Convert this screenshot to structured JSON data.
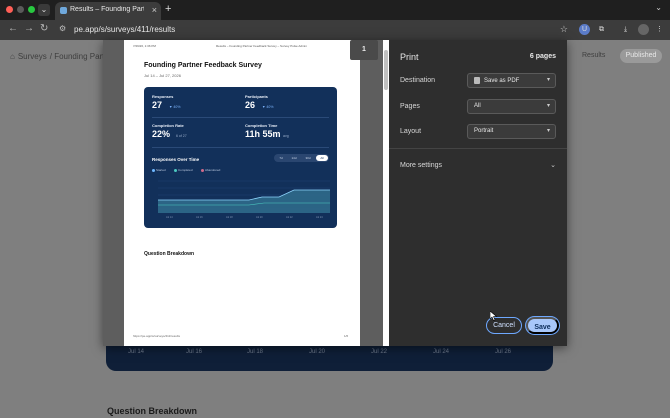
{
  "browser": {
    "tab_title": "Results – Founding Partner F...",
    "tab_close": "×",
    "new_tab": "+",
    "url": "pe.app/s/surveys/411/results",
    "ext_label": "U"
  },
  "page": {
    "breadcrumb": [
      "Surveys",
      "/ Founding Partne"
    ],
    "results_label": "Results",
    "published_label": "Published",
    "x_labels": [
      "Jul 14",
      "Jul 16",
      "Jul 18",
      "Jul 20",
      "Jul 22",
      "Jul 24",
      "Jul 26"
    ],
    "question_breakdown": "Question Breakdown"
  },
  "preview": {
    "header_left": "7/29/26, 1:36 PM",
    "header_center": "Results – Founding Partner Feedback Survey – Survey Pulse Admin",
    "title": "Founding Partner Feedback Survey",
    "date_range": "Jul 14 – Jul 27, 2026",
    "stats": {
      "responses_label": "Responses",
      "responses_value": "27",
      "responses_delta": "▼ 40%",
      "participants_label": "Participants",
      "participants_value": "26",
      "participants_delta": "▼ 40%",
      "completion_rate_label": "Completion Rate",
      "completion_rate_value": "22%",
      "completion_rate_sub": "6 of 27",
      "completion_time_label": "Completion Time",
      "completion_time_value": "11h 55m",
      "completion_time_sub": "avg"
    },
    "chart_title": "Responses Over Time",
    "ranges": [
      "7d",
      "14d",
      "30d",
      "All"
    ],
    "legend": [
      "Started",
      "Completed",
      "Abandoned"
    ],
    "question_breakdown": "Question Breakdown",
    "footer_url": "https://pe.app/s/surveys/411/results",
    "footer_page": "1/6",
    "page_badge": "1"
  },
  "print": {
    "title": "Print",
    "pages_count": "6 pages",
    "destination_label": "Destination",
    "destination_value": "Save as PDF",
    "pages_label": "Pages",
    "pages_value": "All",
    "layout_label": "Layout",
    "layout_value": "Portrait",
    "more_settings": "More settings",
    "cancel": "Cancel",
    "save": "Save"
  },
  "colors": {
    "accent": "#a8c7fa",
    "card": "#12305a"
  }
}
